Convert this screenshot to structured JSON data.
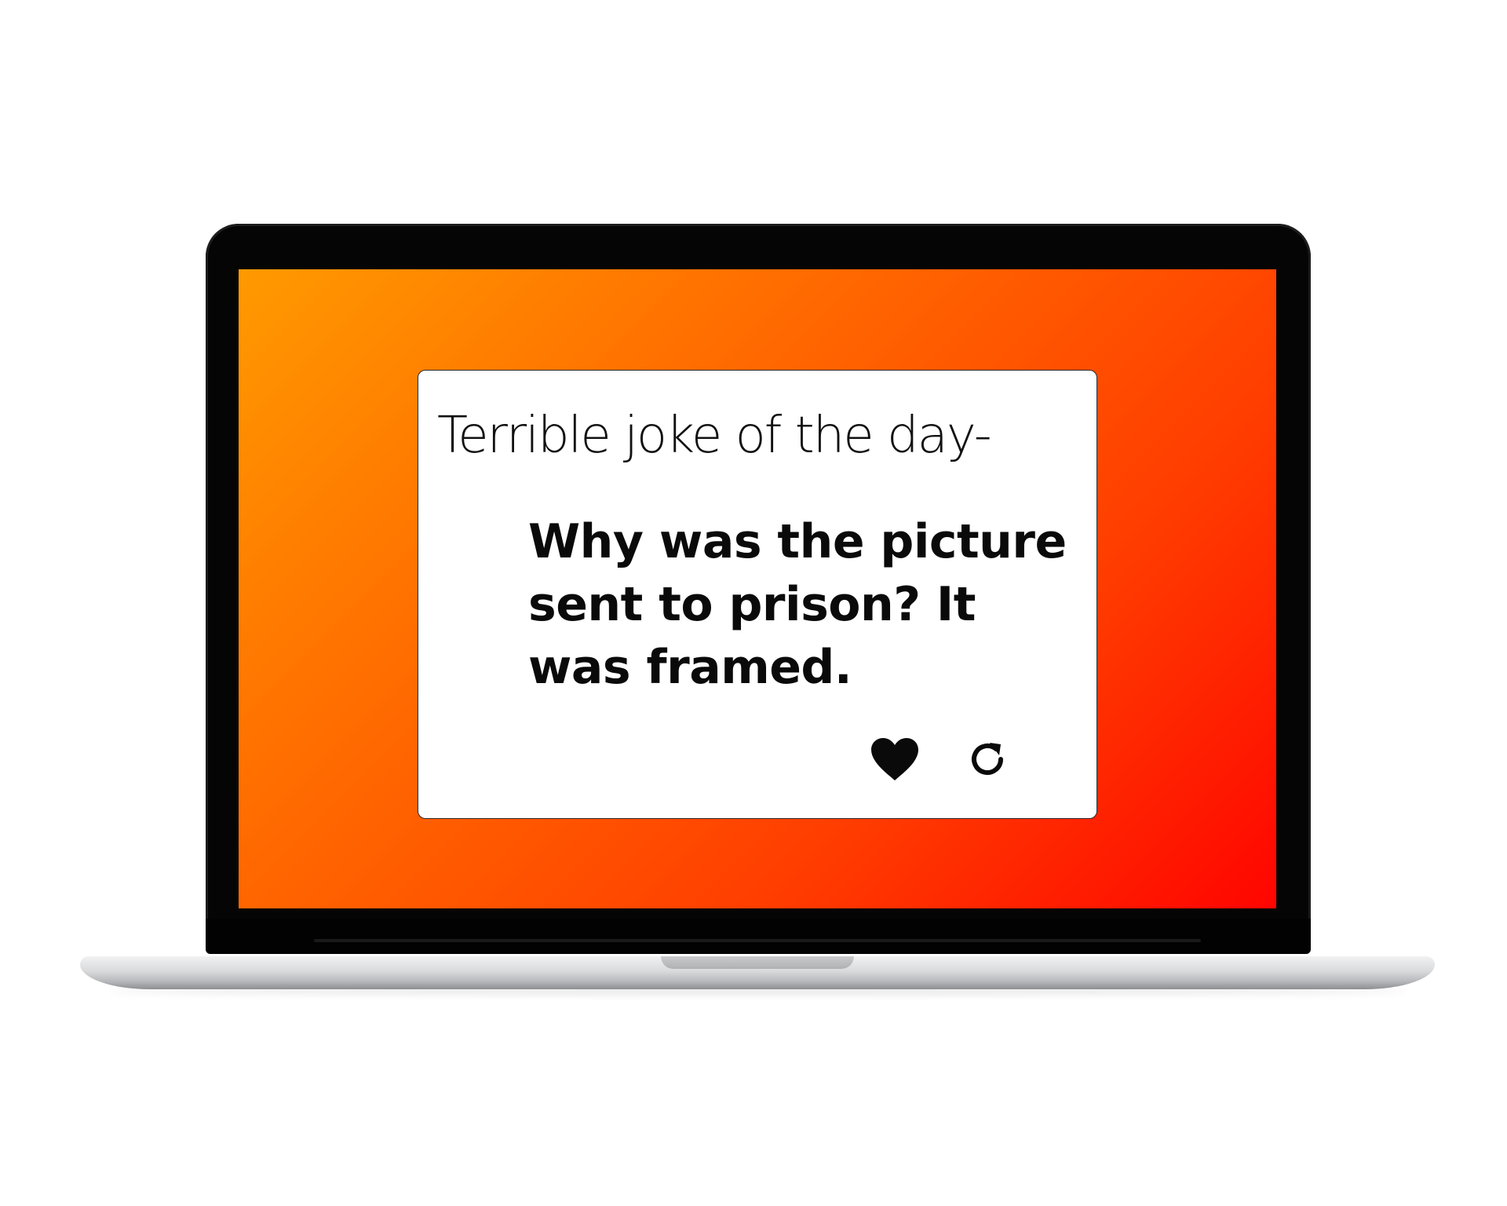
{
  "card": {
    "title": "Terrible joke of the day-",
    "joke": "Why was the picture sent to prison? It was framed."
  },
  "actions": {
    "like_icon": "heart-icon",
    "refresh_icon": "refresh-icon"
  },
  "colors": {
    "gradient_start": "#ff9a00",
    "gradient_end": "#ff0500",
    "card_background": "#ffffff",
    "text": "#0a0a0a"
  }
}
